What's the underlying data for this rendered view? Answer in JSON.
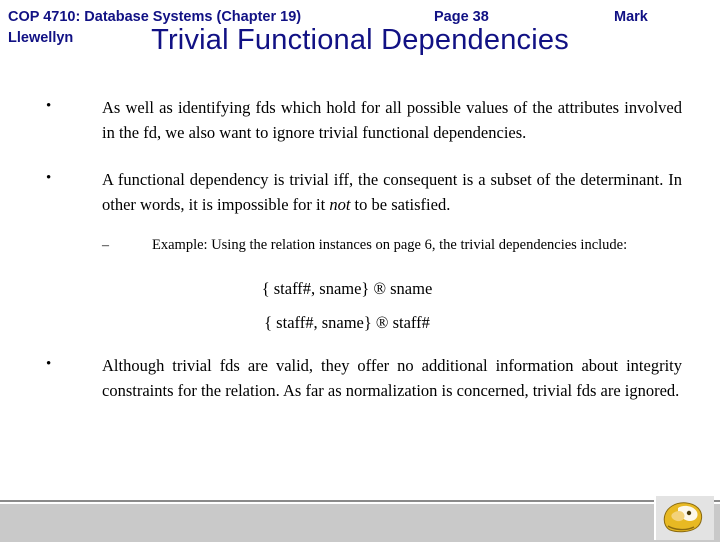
{
  "slide": {
    "title": "Trivial Functional Dependencies",
    "bullets": [
      {
        "marker": "•",
        "text": "As well as identifying fds which hold for all possible values of the attributes involved in the fd, we also want to ignore trivial functional dependencies."
      },
      {
        "marker": "•",
        "text_part1": "A functional dependency is trivial iff, the consequent is a subset of the determinant.   In other words, it is impossible for it ",
        "italic": "not",
        "text_part2": " to be satisfied."
      },
      {
        "marker": "•",
        "text": "Although trivial fds are valid, they offer no additional information about integrity constraints for the relation.  As far as normalization is concerned, trivial fds are ignored."
      }
    ],
    "sub_bullet": {
      "marker": "–",
      "text": "Example:     Using  the  relation  instances  on  page  6,  the  trivial dependencies include:"
    },
    "examples": [
      "{ staff#, sname} ® sname",
      "{ staff#, sname} ® staff#"
    ]
  },
  "footer": {
    "left": "COP 4710: Database Systems  (Chapter 19)",
    "center": "Page 38",
    "right": "Mark",
    "second_line": "Llewellyn"
  },
  "colors": {
    "title": "#111184",
    "footer_text": "#111184",
    "footer_bar": "#c9c9c9",
    "logo_gold": "#e8b923"
  }
}
